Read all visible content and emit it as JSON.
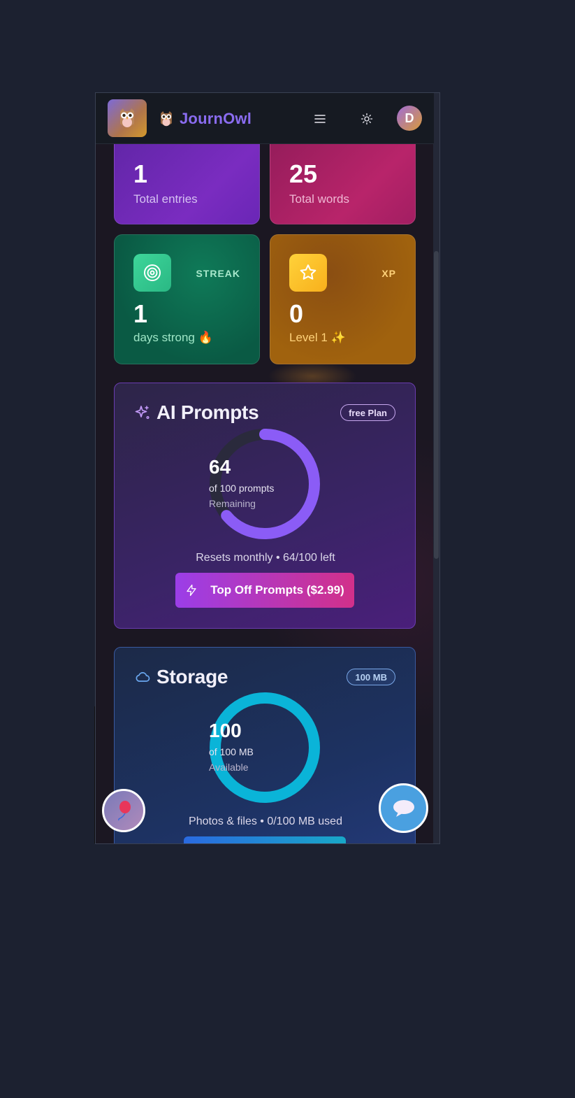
{
  "header": {
    "brand": "JournOwl",
    "avatar_initial": "D",
    "icons": [
      "owl-logo-icon",
      "owl-icon",
      "menu-icon",
      "sun-icon"
    ]
  },
  "stats": {
    "entries": {
      "value": "1",
      "label": "Total entries"
    },
    "words": {
      "value": "25",
      "label": "Total words"
    },
    "streak": {
      "tag": "STREAK",
      "value": "1",
      "label": "days strong 🔥",
      "icon": "target-icon"
    },
    "xp": {
      "tag": "XP",
      "value": "0",
      "label": "Level 1 ✨",
      "icon": "star-icon"
    }
  },
  "ai_prompts": {
    "title": "AI Prompts",
    "badge": "free Plan",
    "ring_value": "64",
    "ring_of": "of 100 prompts",
    "ring_sub": "Remaining",
    "remaining_fraction": 0.64,
    "footer": "Resets monthly • 64/100 left",
    "button": "Top Off Prompts ($2.99)",
    "icon": "sparkles-icon"
  },
  "storage": {
    "title": "Storage",
    "badge": "100 MB",
    "ring_value": "100",
    "ring_of": "of 100 MB",
    "ring_sub": "Available",
    "available_fraction": 1.0,
    "footer": "Photos & files • 0/100 MB used",
    "icon": "cloud-icon"
  },
  "fabs": {
    "left": "balloon-icon",
    "right": "chat-bubble-icon"
  },
  "colors": {
    "brand": "#8a6cf0",
    "ai_ring": "#8b5cf6",
    "storage_ring": "#0ab4d8",
    "streak_tag": "#a8e8cc",
    "xp_tag": "#ffd27a"
  }
}
